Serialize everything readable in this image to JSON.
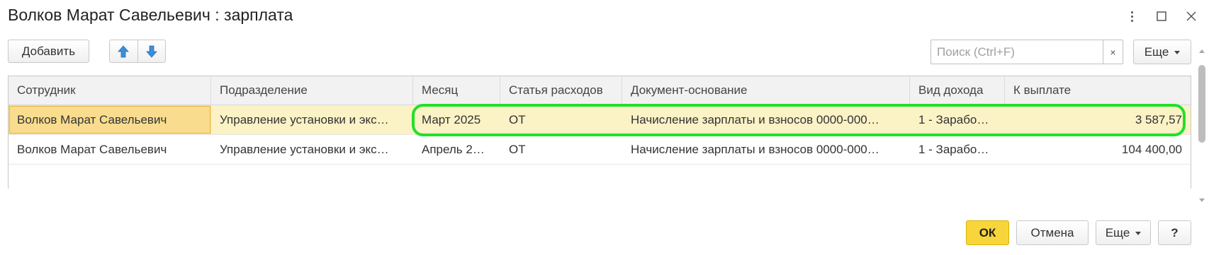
{
  "window": {
    "title": "Волков Марат Савельевич : зарплата"
  },
  "toolbar": {
    "add_label": "Добавить",
    "search_placeholder": "Поиск (Ctrl+F)",
    "search_clear": "×",
    "more_label": "Еще"
  },
  "table": {
    "columns": [
      "Сотрудник",
      "Подразделение",
      "Месяц",
      "Статья расходов",
      "Документ-основание",
      "Вид дохода",
      "К выплате"
    ],
    "rows": [
      [
        "Волков Марат Савельевич",
        "Управление установки и экс…",
        "Март 2025",
        "ОТ",
        "Начисление зарплаты и взносов 0000-000…",
        "1 - Зарабо…",
        "3 587,57"
      ],
      [
        "Волков Марат Савельевич",
        "Управление установки и экс…",
        "Апрель 2…",
        "ОТ",
        "Начисление зарплаты и взносов 0000-000…",
        "1 - Зарабо…",
        "104 400,00"
      ]
    ]
  },
  "footer": {
    "ok_label": "ОК",
    "cancel_label": "Отмена",
    "more_label": "Еще",
    "help_label": "?"
  },
  "colors": {
    "ok_button": "#f8d53b",
    "selected_row": "#fbf2c6",
    "focused_cell": "#f9dc8e",
    "highlight_outline": "#22e02a",
    "arrow_blue": "#3a8fd8"
  },
  "icons": [
    "more-vertical-icon",
    "maximize-icon",
    "close-icon",
    "arrow-up-icon",
    "arrow-down-icon",
    "chevron-down-icon"
  ]
}
